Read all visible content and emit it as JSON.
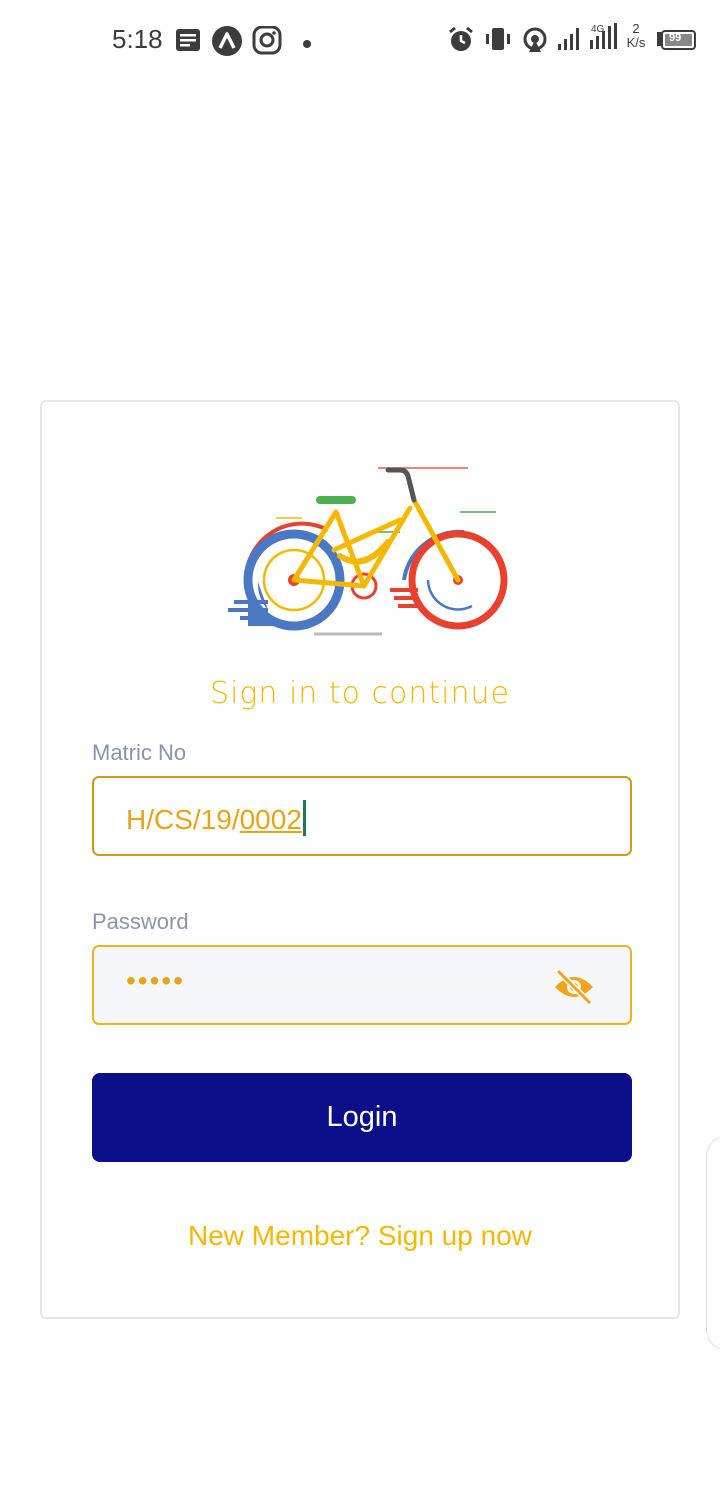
{
  "status_bar": {
    "time": "5:18",
    "network_gen": "4G",
    "speed_value": "2",
    "speed_unit": "K/s",
    "battery": "99",
    "icons": [
      "notes-icon",
      "autocad-icon",
      "instagram-icon",
      "dot-icon",
      "alarm-icon",
      "vibrate-icon",
      "hotspot-icon",
      "signal-icon",
      "signal-icon-2",
      "battery-icon"
    ]
  },
  "login": {
    "heading": "Sign in to continue",
    "matric_label": "Matric No",
    "matric_value_prefix": "H/CS/19/",
    "matric_value_suffix": "0002",
    "password_label": "Password",
    "password_mask": "•••••",
    "password_toggle_icon": "eye-off-icon",
    "login_button": "Login",
    "signup_link": "New Member? Sign up now"
  },
  "colors": {
    "accent": "#f5b800",
    "button": "#0b0f8a",
    "label": "#8a94ab"
  }
}
